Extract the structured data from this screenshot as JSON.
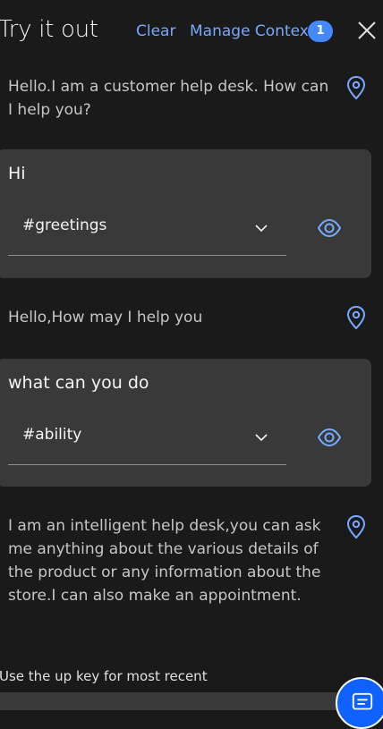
{
  "header": {
    "title": "Try it out",
    "clear_label": "Clear",
    "manage_context_label": "Manage Context",
    "context_count": "1"
  },
  "messages": [
    {
      "type": "bot",
      "text": "Hello.I am a customer help desk. How can I help you?"
    },
    {
      "type": "user",
      "text": "Hi",
      "intent": "#greetings"
    },
    {
      "type": "bot",
      "text": "Hello,How may I help you"
    },
    {
      "type": "user",
      "text": "what can you do",
      "intent": "#ability"
    },
    {
      "type": "bot",
      "text": "I am an intelligent help desk,you can ask me anything about the various details of the product or any information about the store.I can also make an appointment."
    }
  ],
  "footer": {
    "hint": "Use the up key for most recent"
  },
  "icons": {
    "close": "close-icon",
    "location": "location-pin-icon",
    "chevron": "chevron-down-icon",
    "eye": "eye-icon",
    "chat": "chat-icon"
  },
  "colors": {
    "background": "#1a1a1a",
    "card": "#393939",
    "link": "#78a9ff",
    "badge": "#4589ff",
    "fab": "#0f62fe"
  }
}
